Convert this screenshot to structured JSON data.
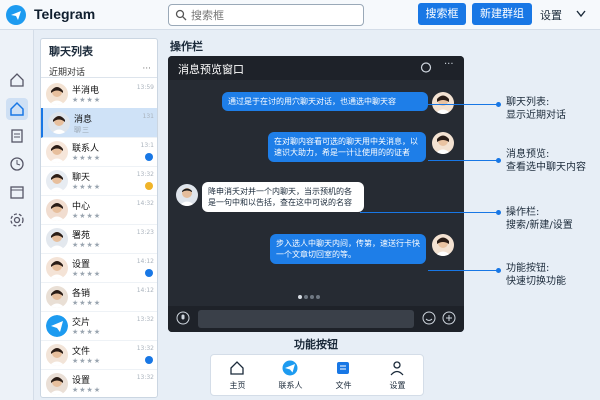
{
  "app": {
    "title": "Telegram"
  },
  "search": {
    "placeholder": "搜索框"
  },
  "toolbar": {
    "search_label": "搜索框",
    "new_group_label": "新建群组",
    "settings_label": "设置"
  },
  "chat_list": {
    "title": "聊天列表",
    "subtitle": "近期对话",
    "rows": [
      {
        "name": "半消电",
        "sub": "★★★★",
        "time": "13:59",
        "badge": ""
      },
      {
        "name": "消息",
        "sub": "聊三",
        "time": "131",
        "badge": ""
      },
      {
        "name": "联系人",
        "sub": "★★★★",
        "time": "13:1",
        "badge": "blue"
      },
      {
        "name": "聊天",
        "sub": "★★★★",
        "time": "13:32",
        "badge": "gold"
      },
      {
        "name": "中心",
        "sub": "★★★★",
        "time": "14:32",
        "badge": ""
      },
      {
        "name": "署苑",
        "sub": "★★★★",
        "time": "13:23",
        "badge": ""
      },
      {
        "name": "设置",
        "sub": "★★★★",
        "time": "14:12",
        "badge": "blue"
      },
      {
        "name": "各销",
        "sub": "★★★★",
        "time": "14:12",
        "badge": ""
      },
      {
        "name": "交片",
        "sub": "★★★★",
        "time": "13:32",
        "badge": ""
      },
      {
        "name": "文件",
        "sub": "★★★★",
        "time": "13:32",
        "badge": "blue"
      },
      {
        "name": "设置",
        "sub": "★★★★",
        "time": "13:32",
        "badge": ""
      }
    ]
  },
  "preview": {
    "section_label": "操作栏",
    "title": "消息预览窗口",
    "messages": [
      {
        "dir": "out",
        "text": "通过是于在讨的用穴聊天对话，也通选中聊天容"
      },
      {
        "dir": "out",
        "text": "在对聊内容看可选的聊天用中关消息，以速识大助力，希是一计让使用的的证者"
      },
      {
        "dir": "in",
        "text": "降申消夭对并一个内聊天，当示预机的各是一句中和以告括，查在这中可说的名容"
      },
      {
        "dir": "out",
        "text": "步入选人中聊天内间，传第，速送行卡快一个文章切回室的等。"
      }
    ]
  },
  "annotations": [
    {
      "text1": "聊天列表:",
      "text2": "显示近期对话"
    },
    {
      "text1": "消息预览:",
      "text2": "查看选中聊天内容"
    },
    {
      "text1": "操作栏:",
      "text2": "搜索/新建/设置"
    },
    {
      "text1": "功能按钮:",
      "text2": "快速切换功能"
    }
  ],
  "bottom_nav": {
    "label": "功能按钮",
    "items": [
      {
        "label": "主页"
      },
      {
        "label": "联系人"
      },
      {
        "label": "文件"
      },
      {
        "label": "设置"
      }
    ]
  },
  "colors": {
    "accent": "#1877e5",
    "preview_bg": "#262b33",
    "bubble_out": "#1e7ee8"
  }
}
